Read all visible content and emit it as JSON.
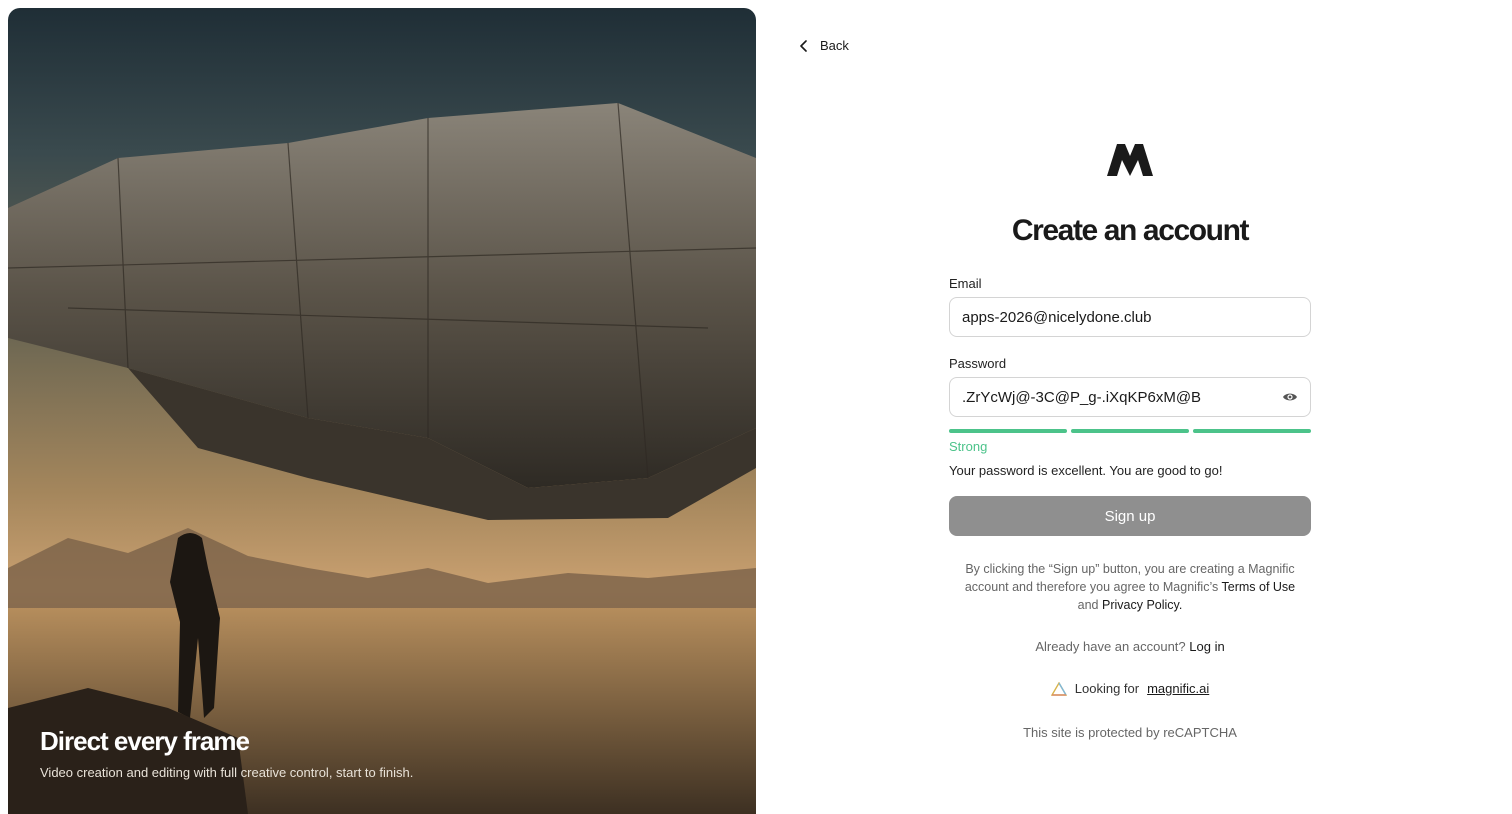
{
  "hero": {
    "title": "Direct every frame",
    "subtitle": "Video creation and editing with full creative control, start to finish."
  },
  "nav": {
    "back_label": "Back"
  },
  "form": {
    "title": "Create an account",
    "email_label": "Email",
    "email_value": "apps-2026@nicelydone.club",
    "password_label": "Password",
    "password_value": ".ZrYcWj@-3C@P_g-.iXqKP6xM@B",
    "strength_segments_filled": 3,
    "strength_segments_total": 3,
    "strength_label": "Strong",
    "strength_message": "Your password is excellent. You are good to go!",
    "signup_label": "Sign up"
  },
  "legal": {
    "prefix": "By clicking the “Sign up” button, you are creating a Magnific account and therefore you agree to Magnific’s ",
    "terms_label": "Terms of Use",
    "and_text": " and ",
    "privacy_label": "Privacy Policy."
  },
  "login": {
    "prompt": "Already have an account?",
    "link_label": "Log in"
  },
  "looking": {
    "prefix": "Looking for",
    "link_label": "magnific.ai"
  },
  "recaptcha_text": "This site is protected by reCAPTCHA",
  "colors": {
    "strength": "#4cc38a",
    "signup_disabled": "#8f8f8f"
  }
}
